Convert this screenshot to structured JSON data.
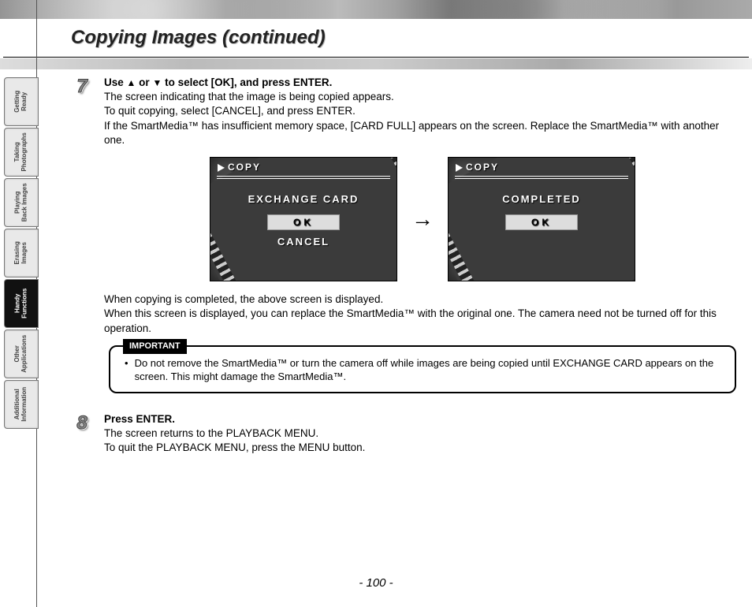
{
  "page": {
    "title": "Copying Images (continued)",
    "page_number": "- 100 -"
  },
  "sideTabs": [
    {
      "id": "getting-ready",
      "label": "Getting\nReady",
      "active": false
    },
    {
      "id": "taking-photographs",
      "label": "Taking\nPhotographs",
      "active": false
    },
    {
      "id": "playing-back-images",
      "label": "Playing\nBack Images",
      "active": false
    },
    {
      "id": "erasing-images",
      "label": "Erasing\nImages",
      "active": false
    },
    {
      "id": "handy-functions",
      "label": "Handy\nFunctions",
      "active": true
    },
    {
      "id": "other-applications",
      "label": "Other\nApplications",
      "active": false
    },
    {
      "id": "additional-information",
      "label": "Additional\nInformation",
      "active": false
    }
  ],
  "step7": {
    "number": "7",
    "heading_parts": {
      "pre": "Use ",
      "mid": " or ",
      "post": " to select [OK], and press ENTER."
    },
    "body1": "The screen indicating that the image is being copied appears.",
    "body2": "To quit copying, select [CANCEL], and press ENTER.",
    "body3": "If the SmartMedia™ has insufficient memory space, [CARD FULL] appears on the screen. Replace the SmartMedia™ with another one.",
    "after1": "When copying is completed, the above screen is displayed.",
    "after2": "When this screen is displayed, you can replace the SmartMedia™ with the original one. The camera need not be turned off for this operation."
  },
  "screens": {
    "copy_label": "COPY",
    "exchange_card": "EXCHANGE CARD",
    "completed": "COMPLETED",
    "ok": "OK",
    "cancel": "CANCEL"
  },
  "important": {
    "tag": "IMPORTANT",
    "text": "Do not remove the SmartMedia™ or turn the camera off while images are being copied until EXCHANGE CARD appears on the screen. This might damage the SmartMedia™."
  },
  "step8": {
    "number": "8",
    "heading": "Press ENTER.",
    "body1": "The screen returns to the PLAYBACK MENU.",
    "body2": "To quit the PLAYBACK MENU, press the MENU button."
  },
  "icons": {
    "up": "▲",
    "down": "▼",
    "arrow_right": "→",
    "bullet": "•"
  }
}
